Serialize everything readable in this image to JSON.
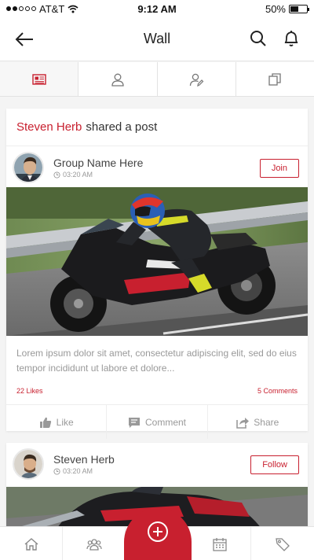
{
  "status_bar": {
    "carrier": "AT&T",
    "time": "9:12 AM",
    "battery": "50%",
    "battery_level": 0.5
  },
  "header": {
    "title": "Wall",
    "back_icon": "arrow-left-icon",
    "search_icon": "search-icon",
    "bell_icon": "bell-icon"
  },
  "tabs": [
    {
      "icon": "newspaper-icon",
      "active": true
    },
    {
      "icon": "user-icon",
      "active": false
    },
    {
      "icon": "user-edit-icon",
      "active": false
    },
    {
      "icon": "copy-icon",
      "active": false
    }
  ],
  "posts": [
    {
      "actor": "Steven Herb",
      "verb": "shared a post",
      "author": "Group Name Here",
      "time": "03:20 AM",
      "action_button": "Join",
      "image": "motorcycle-racer-photo",
      "text": "Lorem ipsum dolor sit amet, consectetur adipiscing elit,  sed do eius tempor incididunt ut labore et dolore...",
      "likes": "22 Likes",
      "comments": "5 Comments",
      "actions": {
        "like": "Like",
        "comment": "Comment",
        "share": "Share"
      }
    },
    {
      "author": "Steven Herb",
      "time": "03:20 AM",
      "action_button": "Follow",
      "image": "motorcycle-photo"
    }
  ],
  "bottom_nav": [
    {
      "icon": "home-icon"
    },
    {
      "icon": "group-icon"
    },
    {
      "icon": "add-circle-icon"
    },
    {
      "icon": "calendar-icon"
    },
    {
      "icon": "tag-icon"
    }
  ],
  "colors": {
    "accent": "#c8202f",
    "muted": "#999999"
  }
}
